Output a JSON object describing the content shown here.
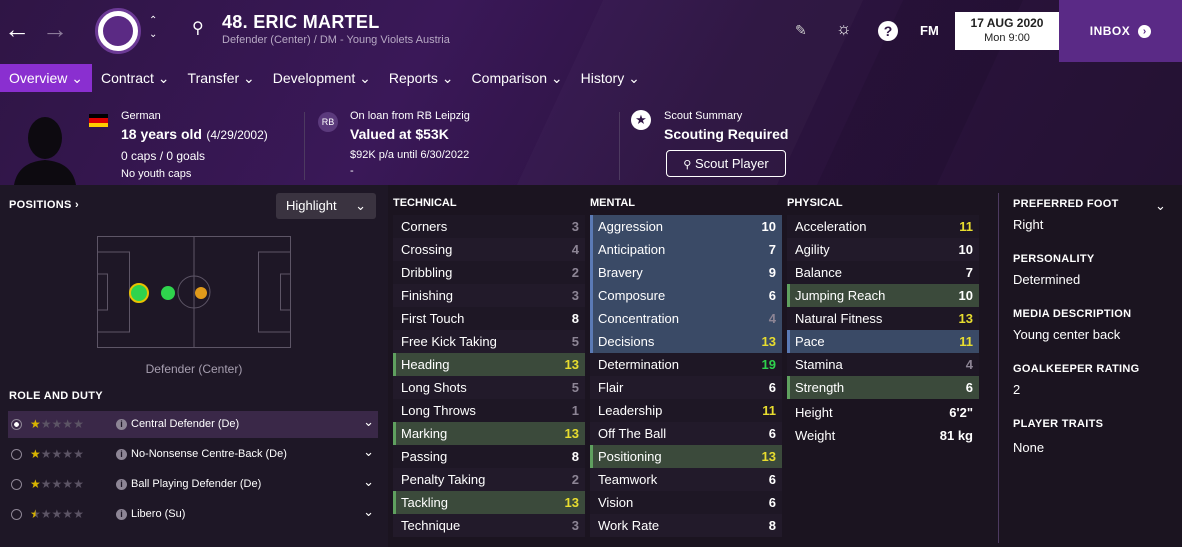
{
  "header": {
    "number_name": "48. ERIC MARTEL",
    "subtitle": "Defender (Center) / DM - Young Violets Austria",
    "fm": "FM",
    "date": "17 AUG 2020",
    "day_time": "Mon 9:00",
    "inbox": "INBOX"
  },
  "tabs": [
    "Overview",
    "Contract",
    "Transfer",
    "Development",
    "Reports",
    "Comparison",
    "History"
  ],
  "info": {
    "nationality": "German",
    "age": "18 years old",
    "dob": "(4/29/2002)",
    "caps": "0 caps / 0 goals",
    "youth_caps": "No youth caps",
    "loan_label": "On loan from RB Leipzig",
    "value": "Valued at $53K",
    "wage": "$92K p/a until 6/30/2022",
    "dash": "-",
    "scout_label": "Scout Summary",
    "scout_status": "Scouting Required",
    "scout_button": "Scout Player"
  },
  "positions": {
    "title": "POSITIONS",
    "highlight": "Highlight",
    "position_name": "Defender (Center)"
  },
  "roles": {
    "title": "ROLE AND DUTY",
    "items": [
      {
        "label": "Central Defender (De)",
        "stars": 1
      },
      {
        "label": "No-Nonsense Centre-Back (De)",
        "stars": 1
      },
      {
        "label": "Ball Playing Defender (De)",
        "stars": 1
      },
      {
        "label": "Libero (Su)",
        "stars": 0.5
      }
    ]
  },
  "technical": {
    "title": "TECHNICAL",
    "items": [
      {
        "n": "Corners",
        "v": "3"
      },
      {
        "n": "Crossing",
        "v": "4"
      },
      {
        "n": "Dribbling",
        "v": "2"
      },
      {
        "n": "Finishing",
        "v": "3"
      },
      {
        "n": "First Touch",
        "v": "8"
      },
      {
        "n": "Free Kick Taking",
        "v": "5"
      },
      {
        "n": "Heading",
        "v": "13"
      },
      {
        "n": "Long Shots",
        "v": "5"
      },
      {
        "n": "Long Throws",
        "v": "1"
      },
      {
        "n": "Marking",
        "v": "13"
      },
      {
        "n": "Passing",
        "v": "8"
      },
      {
        "n": "Penalty Taking",
        "v": "2"
      },
      {
        "n": "Tackling",
        "v": "13"
      },
      {
        "n": "Technique",
        "v": "3"
      }
    ]
  },
  "mental": {
    "title": "MENTAL",
    "items": [
      {
        "n": "Aggression",
        "v": "10"
      },
      {
        "n": "Anticipation",
        "v": "7"
      },
      {
        "n": "Bravery",
        "v": "9"
      },
      {
        "n": "Composure",
        "v": "6"
      },
      {
        "n": "Concentration",
        "v": "4"
      },
      {
        "n": "Decisions",
        "v": "13"
      },
      {
        "n": "Determination",
        "v": "19"
      },
      {
        "n": "Flair",
        "v": "6"
      },
      {
        "n": "Leadership",
        "v": "11"
      },
      {
        "n": "Off The Ball",
        "v": "6"
      },
      {
        "n": "Positioning",
        "v": "13"
      },
      {
        "n": "Teamwork",
        "v": "6"
      },
      {
        "n": "Vision",
        "v": "6"
      },
      {
        "n": "Work Rate",
        "v": "8"
      }
    ]
  },
  "physical": {
    "title": "PHYSICAL",
    "items": [
      {
        "n": "Acceleration",
        "v": "11"
      },
      {
        "n": "Agility",
        "v": "10"
      },
      {
        "n": "Balance",
        "v": "7"
      },
      {
        "n": "Jumping Reach",
        "v": "10"
      },
      {
        "n": "Natural Fitness",
        "v": "13"
      },
      {
        "n": "Pace",
        "v": "11"
      },
      {
        "n": "Stamina",
        "v": "4"
      },
      {
        "n": "Strength",
        "v": "6"
      }
    ],
    "height_label": "Height",
    "height": "6'2\"",
    "weight_label": "Weight",
    "weight": "81 kg"
  },
  "right": {
    "foot_label": "PREFERRED FOOT",
    "foot": "Right",
    "personality_label": "PERSONALITY",
    "personality": "Determined",
    "media_label": "MEDIA DESCRIPTION",
    "media": "Young center back",
    "gk_label": "GOALKEEPER RATING",
    "gk": "2",
    "traits_label": "PLAYER TRAITS",
    "traits": "None"
  },
  "colors": {
    "accent": "#8a2fd0",
    "inbox": "#5a2a86",
    "yellow": "#e8dd2f",
    "green": "#2fd34d",
    "grey": "#8d8595"
  }
}
